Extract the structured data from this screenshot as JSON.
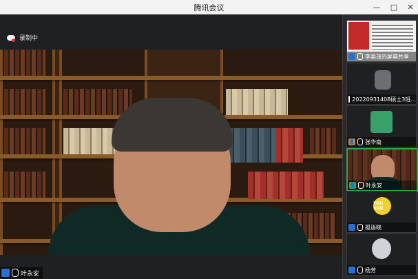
{
  "window": {
    "title": "腾讯会议"
  },
  "stage": {
    "recording_label": "录制中",
    "speaker_name": "叶永安"
  },
  "participants": [
    {
      "name": "李美茂的屏幕共享"
    },
    {
      "name": "20220931408硕士3班..."
    },
    {
      "name": "张华南"
    },
    {
      "name": "叶永安"
    },
    {
      "name": "孤语晓"
    },
    {
      "name": "杨芳"
    }
  ],
  "tile_text": {
    "sun": "YOU SUN"
  },
  "colors": {
    "accent": "#2ea44f",
    "brand_blue": "#2f6fd1",
    "record_red": "#e53935"
  }
}
